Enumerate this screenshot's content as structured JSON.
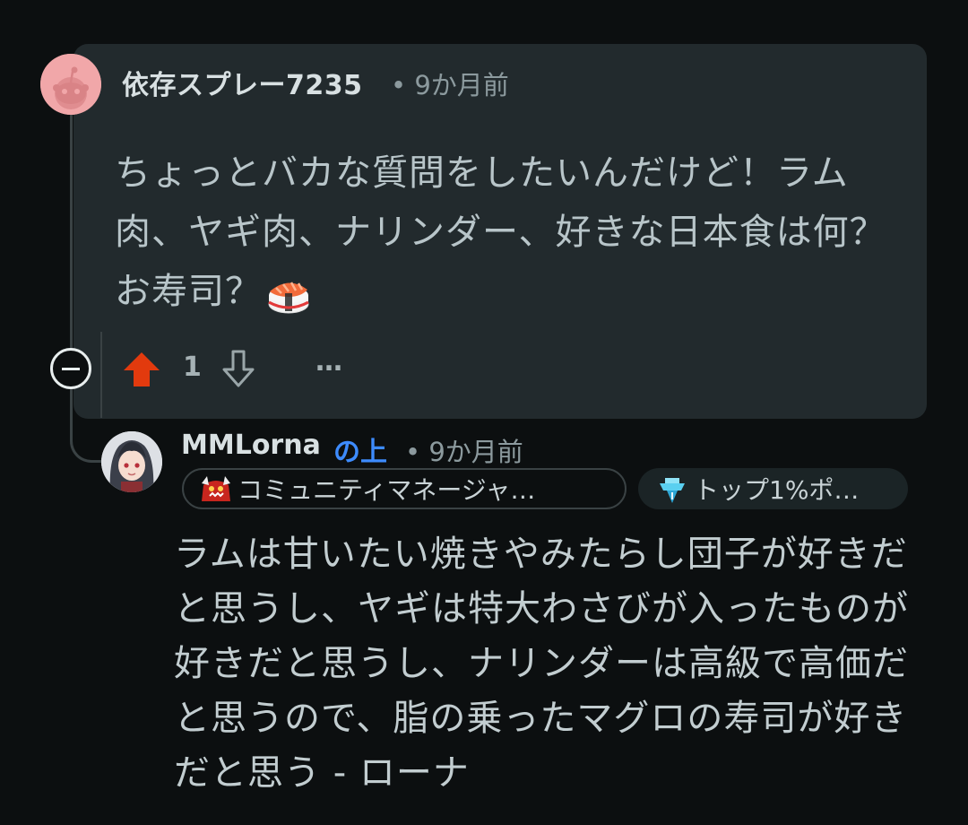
{
  "comment": {
    "username": "依存スプレー7235",
    "separator": "•",
    "time": "9か月前",
    "body": "ちょっとバカな質問をしたいんだけど！ラム肉、ヤギ肉、ナリンダー、好きな日本食は何？お寿司？",
    "emoji": "sushi-icon",
    "vote_count": "1",
    "more": "…"
  },
  "reply": {
    "username": "MMLorna",
    "op_tag": "の上",
    "separator": "•",
    "time": "9か月前",
    "flair1": "コミュニティマネージャ…",
    "flair2": "トップ1%ポ…",
    "body": "ラムは甘いたい焼きやみたらし団子が好きだと思うし、ヤギは特大わさびが入ったものが好きだと思うし、ナリンダーは高級で高価だと思うので、脂の乗ったマグロの寿司が好きだと思う - ローナ"
  },
  "colors": {
    "background": "#0c0f10",
    "card": "#222a2d",
    "upvote": "#e23a0e",
    "op_tag": "#3d8bfd"
  }
}
